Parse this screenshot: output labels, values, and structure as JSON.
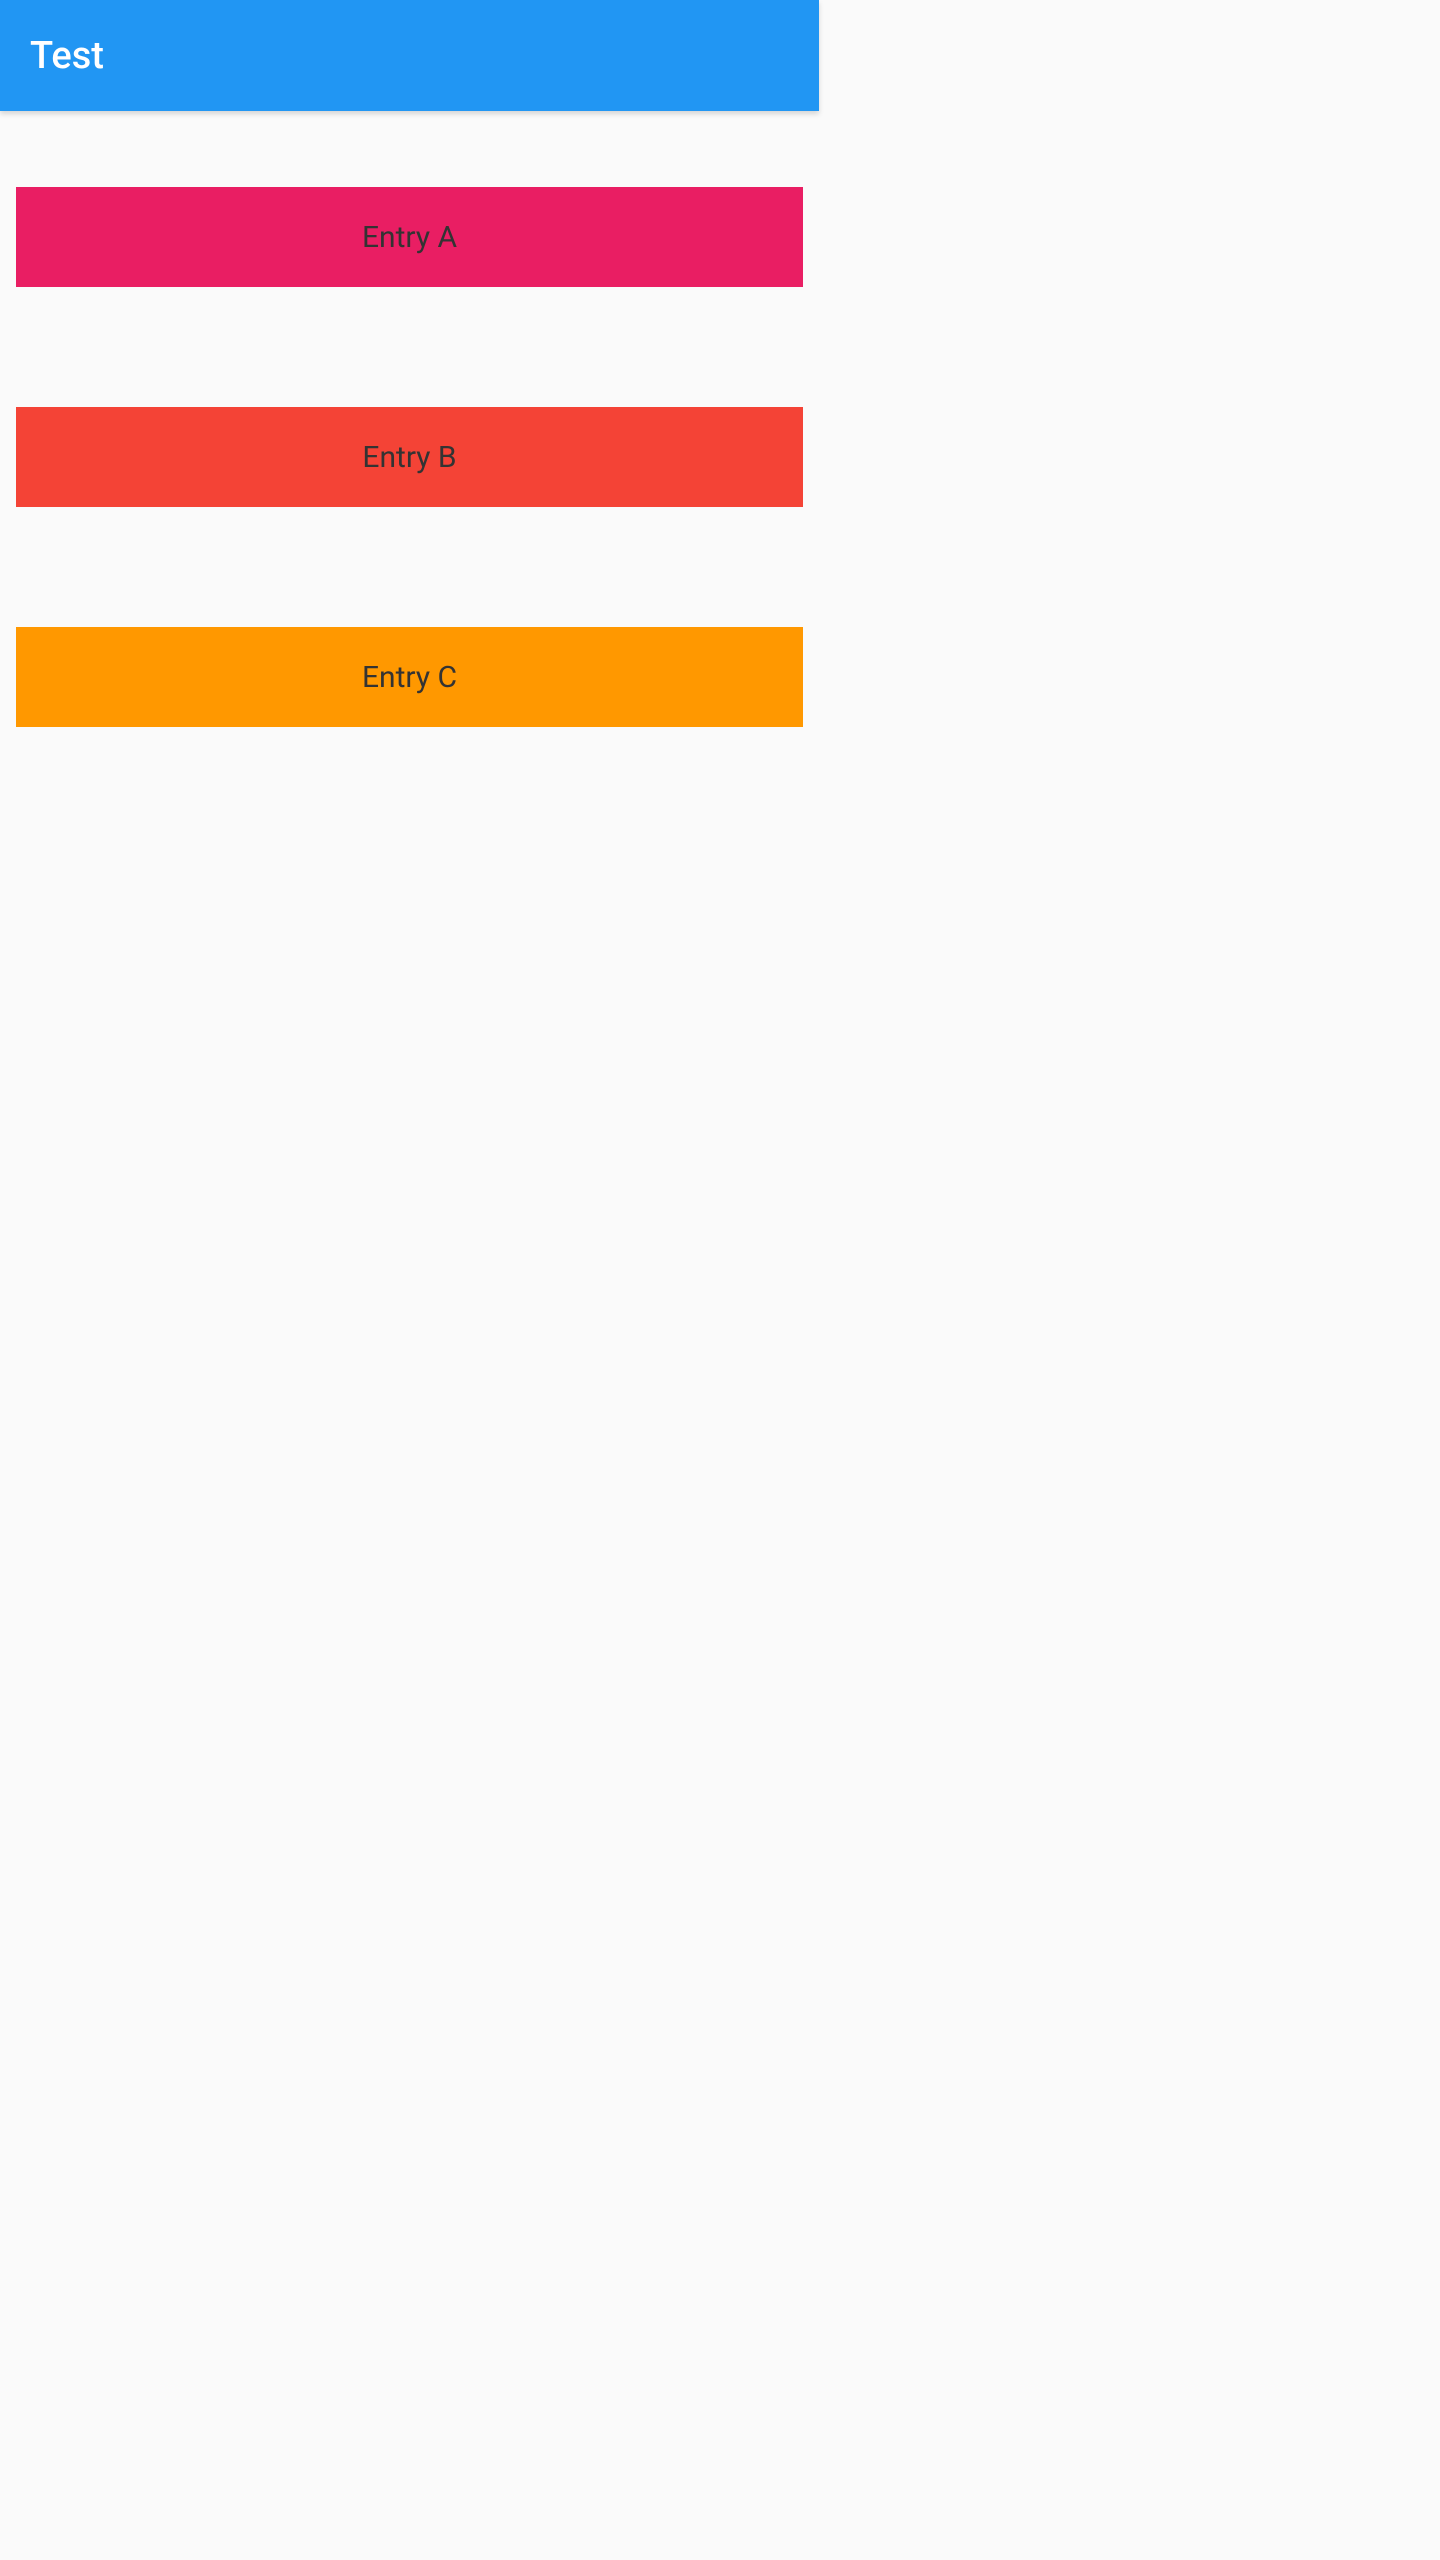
{
  "header": {
    "title": "Test"
  },
  "entries": [
    {
      "label": "Entry A",
      "color": "#e91e63"
    },
    {
      "label": "Entry B",
      "color": "#f44336"
    },
    {
      "label": "Entry C",
      "color": "#ff9800"
    }
  ]
}
